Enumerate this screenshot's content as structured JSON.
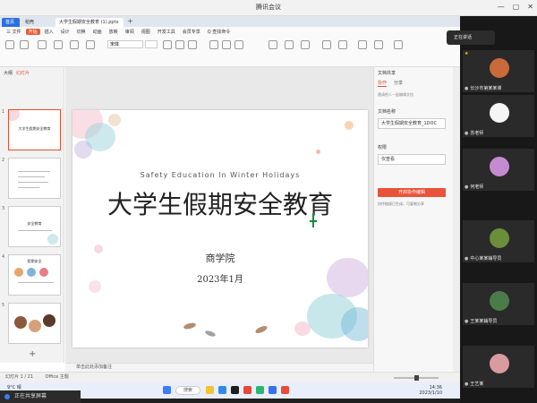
{
  "meeting": {
    "title": "腾讯会议"
  },
  "wps": {
    "tabs": [
      "首页",
      "稻壳",
      "大学生假期安全教育 (1).pptx"
    ],
    "menu": [
      "三 文件",
      "开始",
      "插入",
      "设计",
      "切换",
      "动画",
      "放映",
      "审阅",
      "视图",
      "开发工具",
      "会员专享",
      "Q 查找命令"
    ],
    "active_menu": "开始",
    "ribbon_font": "宋体",
    "left_tabs": [
      "大纲",
      "幻灯片"
    ],
    "slides": [
      {
        "num": "1",
        "title": "大学生假期安全教育"
      },
      {
        "num": "2",
        "title": ""
      },
      {
        "num": "3",
        "title": "安全教育"
      },
      {
        "num": "4",
        "title": "假期安全"
      },
      {
        "num": "5",
        "title": ""
      }
    ],
    "add_slide": "+",
    "notes": "单击此处添加备注",
    "status_left": "幻灯片 1 / 21",
    "status_theme": "Office 主题"
  },
  "slide": {
    "subtitle": "Safety Education In Winter Holidays",
    "title": "大学生假期安全教育",
    "school": "商学院",
    "date": "2023年1月"
  },
  "right_panel": {
    "head": "文档共享",
    "tabs": [
      "协作",
      "分享"
    ],
    "hint": "邀请他人一起编辑文档",
    "label1": "文档名称",
    "value1": "大学生假期安全教育_1DOC",
    "label2": "权限",
    "value2": "仅查看",
    "button": "开启协作编辑",
    "small": "协作链接已生成，可复制分享"
  },
  "taskbar": {
    "weather": "9°C 晴",
    "search": "搜索",
    "time": "14:36",
    "date": "2023/1/10"
  },
  "share_banner": "正在共享屏幕",
  "float_ctrl": "正在讲话",
  "participants": [
    {
      "name": "长沙市第某某课",
      "color": "#c96a3a",
      "pin": true
    },
    {
      "name": "苏老师",
      "color": "#f5f5f5",
      "pin": false
    },
    {
      "name": "何老师",
      "color": "#c58ad1",
      "pin": false
    },
    {
      "name": "中心某某辅导员",
      "color": "#6b8e3a",
      "pin": false
    },
    {
      "name": "王某某辅导员",
      "color": "#4a7c4a",
      "pin": false
    },
    {
      "name": "王艺某",
      "color": "#d99aa0",
      "pin": false
    }
  ]
}
